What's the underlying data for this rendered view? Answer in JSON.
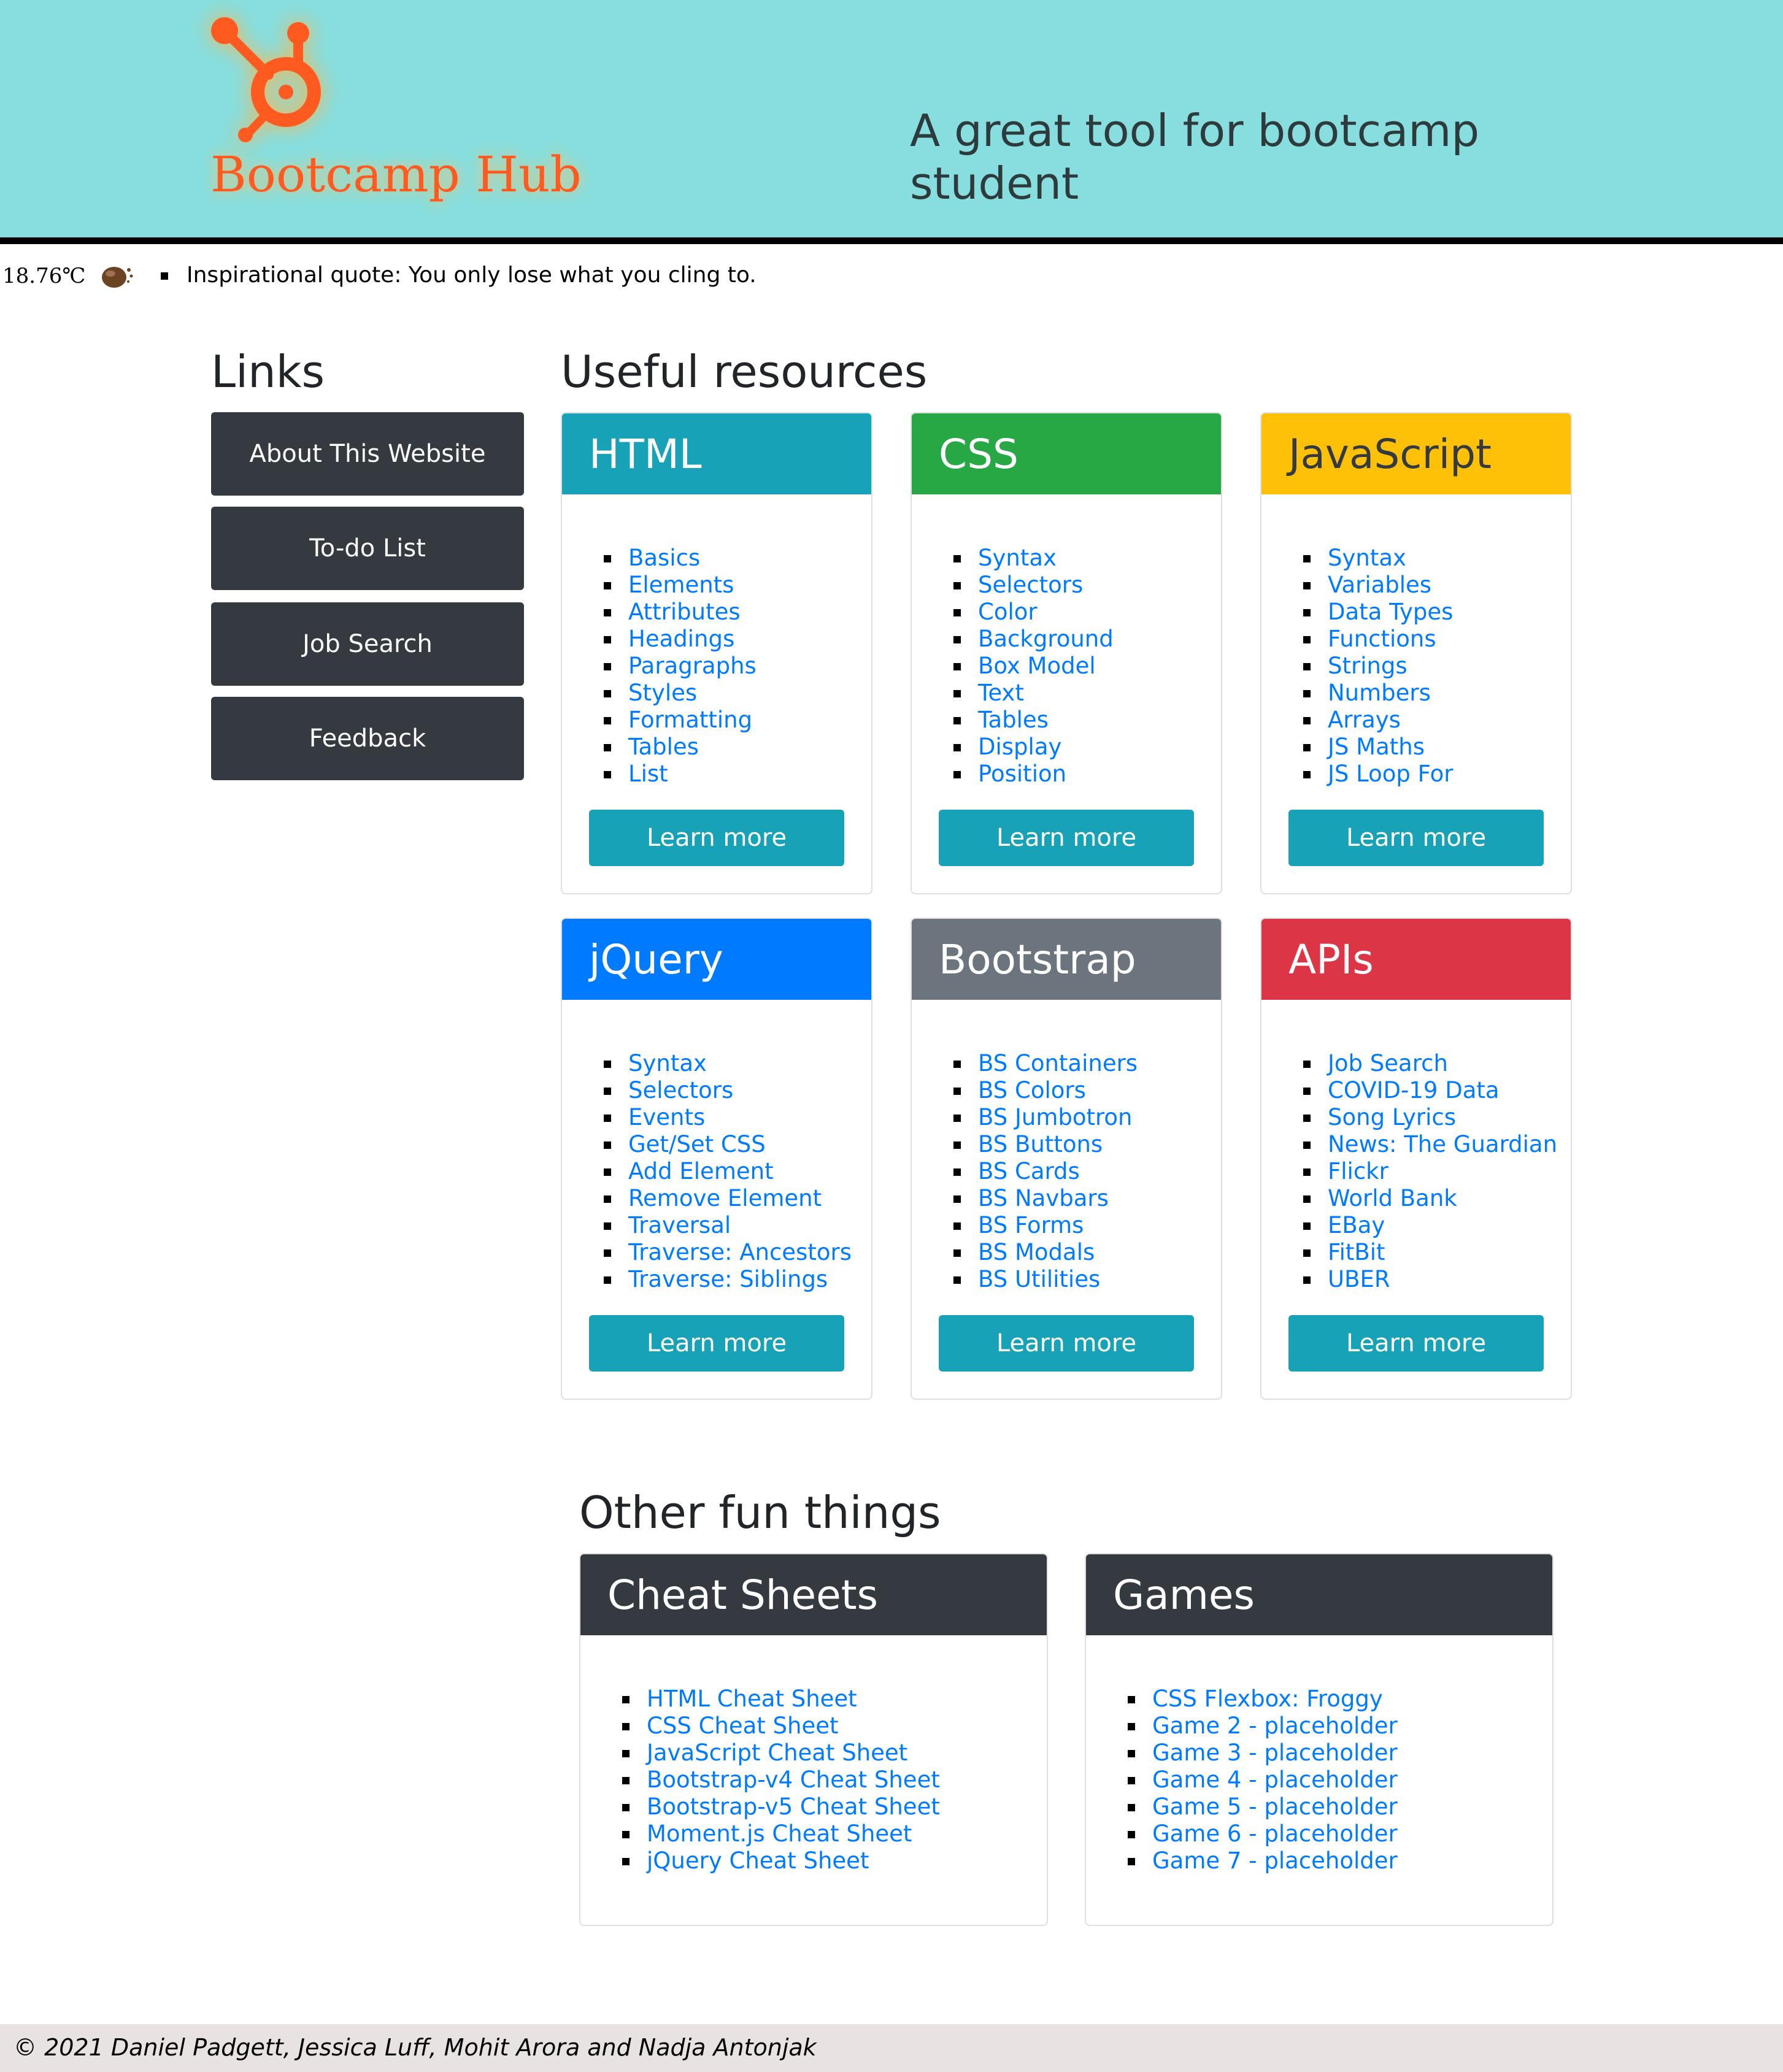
{
  "header": {
    "brand": "Bootcamp Hub",
    "tagline": "A great tool for bootcamp student",
    "logo_icon": "hubspot-sprocket-icon",
    "logo_color": "#ff5a1f",
    "background": "#88dede"
  },
  "strip": {
    "temperature": "18.76℃",
    "weather_icon": "weather-icon",
    "quote": "Inspirational quote: You only lose what you cling to."
  },
  "links": {
    "title": "Links",
    "items": [
      "About This Website",
      "To-do List",
      "Job Search",
      "Feedback"
    ]
  },
  "resources": {
    "title": "Useful resources",
    "cards": [
      {
        "title": "HTML",
        "color": "#17a2b8",
        "text_color": "#ffffff",
        "items": [
          "Basics",
          "Elements",
          "Attributes",
          "Headings",
          "Paragraphs",
          "Styles",
          "Formatting",
          "Tables",
          "List"
        ],
        "button": "Learn more"
      },
      {
        "title": "CSS",
        "color": "#28a745",
        "text_color": "#ffffff",
        "items": [
          "Syntax",
          "Selectors",
          "Color",
          "Background",
          "Box Model",
          "Text",
          "Tables",
          "Display",
          "Position"
        ],
        "button": "Learn more"
      },
      {
        "title": "JavaScript",
        "color": "#ffc107",
        "text_color": "#343a40",
        "items": [
          "Syntax",
          "Variables",
          "Data Types",
          "Functions",
          "Strings",
          "Numbers",
          "Arrays",
          "JS Maths",
          "JS Loop For"
        ],
        "button": "Learn more"
      },
      {
        "title": "jQuery",
        "color": "#007bff",
        "text_color": "#ffffff",
        "items": [
          "Syntax",
          "Selectors",
          "Events",
          "Get/Set CSS",
          "Add Element",
          "Remove Element",
          "Traversal",
          "Traverse: Ancestors",
          "Traverse: Siblings"
        ],
        "button": "Learn more"
      },
      {
        "title": "Bootstrap",
        "color": "#6c757d",
        "text_color": "#ffffff",
        "items": [
          "BS Containers",
          "BS Colors",
          "BS Jumbotron",
          "BS Buttons",
          "BS Cards",
          "BS Navbars",
          "BS Forms",
          "BS Modals",
          "BS Utilities"
        ],
        "button": "Learn more"
      },
      {
        "title": "APIs",
        "color": "#dc3545",
        "text_color": "#ffffff",
        "items": [
          "Job Search",
          "COVID-19 Data",
          "Song Lyrics",
          "News: The Guardian",
          "Flickr",
          "World Bank",
          "EBay",
          "FitBit",
          "UBER"
        ],
        "button": "Learn more"
      }
    ]
  },
  "fun": {
    "title": "Other fun things",
    "cards": [
      {
        "title": "Cheat Sheets",
        "color": "#343a40",
        "text_color": "#ffffff",
        "items": [
          "HTML Cheat Sheet",
          "CSS Cheat Sheet",
          "JavaScript Cheat Sheet",
          "Bootstrap-v4 Cheat Sheet",
          "Bootstrap-v5 Cheat Sheet",
          "Moment.js Cheat Sheet",
          "jQuery Cheat Sheet"
        ]
      },
      {
        "title": "Games",
        "color": "#343a40",
        "text_color": "#ffffff",
        "items": [
          "CSS Flexbox: Froggy",
          "Game 2 - placeholder",
          "Game 3 - placeholder",
          "Game 4 - placeholder",
          "Game 5 - placeholder",
          "Game 6 - placeholder",
          "Game 7 - placeholder"
        ]
      }
    ]
  },
  "footer": {
    "text": "© 2021 Daniel Padgett, Jessica Luff, Mohit Arora and Nadja Antonjak"
  }
}
